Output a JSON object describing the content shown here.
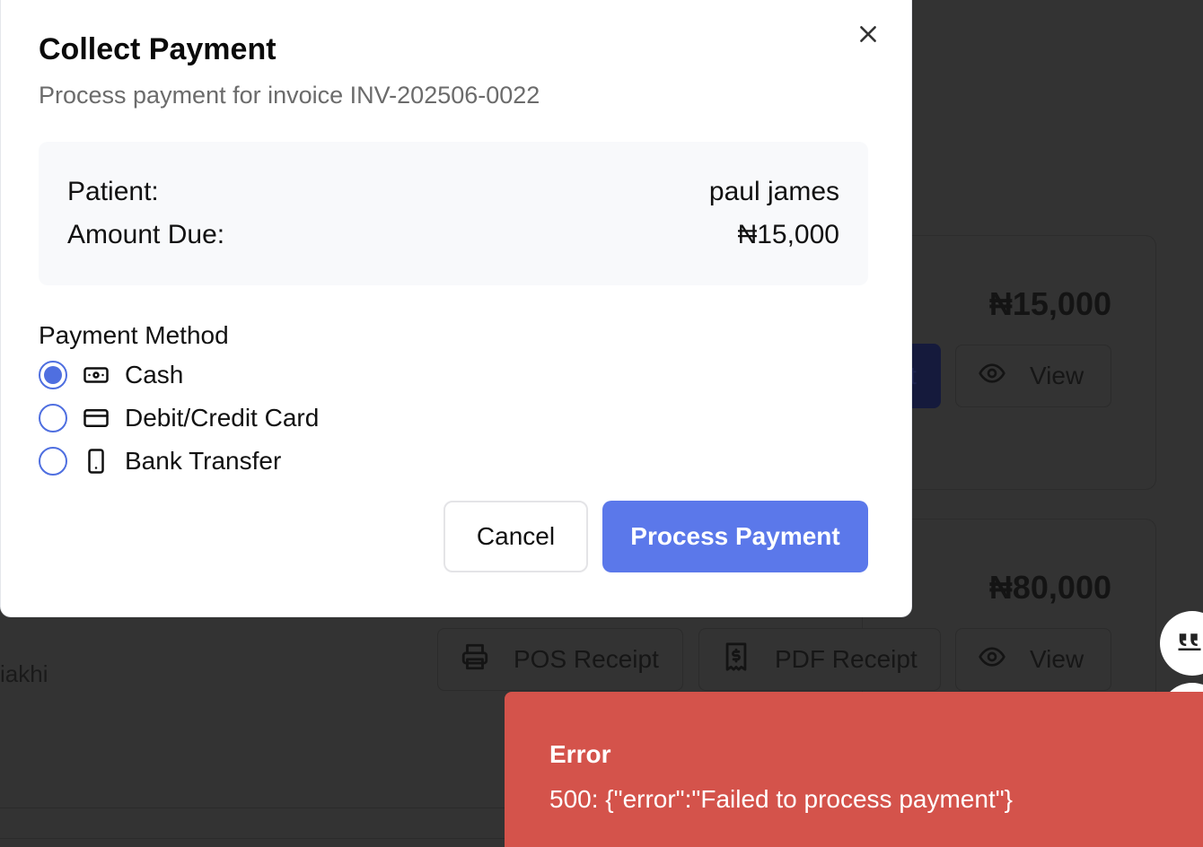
{
  "modal": {
    "title": "Collect Payment",
    "subtitle": "Process payment for invoice INV-202506-0022",
    "summary": {
      "patient_label": "Patient:",
      "patient_value": "paul james",
      "amount_label": "Amount Due:",
      "amount_value": "₦15,000"
    },
    "payment_method_label": "Payment Method",
    "options": [
      {
        "label": "Cash",
        "icon": "cash-icon",
        "selected": true
      },
      {
        "label": "Debit/Credit Card",
        "icon": "credit-card-icon",
        "selected": false
      },
      {
        "label": "Bank Transfer",
        "icon": "smartphone-icon",
        "selected": false
      }
    ],
    "cancel_label": "Cancel",
    "submit_label": "Process Payment",
    "accent_color": "#5b78ea"
  },
  "background": {
    "card1_amount": "₦15,000",
    "card1_partial_btn": "t",
    "card1_view_label": "View",
    "card2_amount": "₦80,000",
    "card2_pos_label": "POS Receipt",
    "card2_pdf_label": "PDF Receipt",
    "card2_view_label": "View",
    "left_partial_text": "iakhi"
  },
  "toast": {
    "title": "Error",
    "message": "500: {\"error\":\"Failed to process payment\"}",
    "color": "#d4534b"
  }
}
